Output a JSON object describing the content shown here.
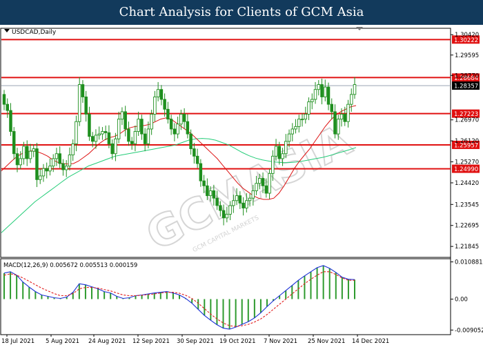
{
  "banner": {
    "title": "Chart Analysis for Clients of GCM Asia"
  },
  "colors": {
    "banner": "#123a5c",
    "bull_candle": "#1e8f1e",
    "bear_candle": "#1e8f1e",
    "ma_fast": "#dd1111",
    "ma_slow": "#22cc77",
    "level_line": "#e01010",
    "macd_main": "#1a2fd6",
    "macd_signal": "#e21b1b",
    "macd_hist": "#2d9a2d",
    "price_box": "#000000"
  },
  "chart_data": [
    {
      "type": "candlestick",
      "symbol_label": "USDCAD,Daily",
      "ylim": [
        1.2143,
        1.3065
      ],
      "y_ticks": [
        1.3042,
        1.29595,
        1.2877,
        1.2697,
        1.2612,
        1.2527,
        1.2442,
        1.23545,
        1.22695,
        1.21845
      ],
      "x_tick_labels": [
        "18 Jul 2021",
        "5 Aug 2021",
        "24 Aug 2021",
        "12 Sep 2021",
        "30 Sep 2021",
        "19 Oct 2021",
        "7 Nov 2021",
        "25 Nov 2021",
        "14 Dec 2021"
      ],
      "horizontal_levels": [
        {
          "value": 1.30222,
          "label": "1.30222"
        },
        {
          "value": 1.28684,
          "label": "1.28684"
        },
        {
          "value": 1.27223,
          "label": "1.27223"
        },
        {
          "value": 1.25957,
          "label": "1.25957"
        },
        {
          "value": 1.2499,
          "label": "1.24990"
        }
      ],
      "current_price": {
        "value": 1.28357,
        "label": "1.28357"
      },
      "close": [
        1.276,
        1.2735,
        1.265,
        1.256,
        1.2515,
        1.254,
        1.259,
        1.254,
        1.257,
        1.258,
        1.2455,
        1.247,
        1.25,
        1.249,
        1.251,
        1.254,
        1.256,
        1.252,
        1.2495,
        1.251,
        1.2555,
        1.26,
        1.269,
        1.284,
        1.279,
        1.272,
        1.263,
        1.261,
        1.2635,
        1.264,
        1.265,
        1.2645,
        1.26,
        1.256,
        1.262,
        1.27,
        1.273,
        1.266,
        1.261,
        1.26,
        1.265,
        1.27,
        1.264,
        1.26,
        1.266,
        1.272,
        1.279,
        1.282,
        1.278,
        1.274,
        1.27,
        1.266,
        1.264,
        1.268,
        1.272,
        1.269,
        1.264,
        1.258,
        1.255,
        1.252,
        1.245,
        1.243,
        1.239,
        1.241,
        1.238,
        1.235,
        1.233,
        1.23,
        1.2315,
        1.235,
        1.237,
        1.239,
        1.236,
        1.234,
        1.237,
        1.238,
        1.241,
        1.244,
        1.246,
        1.243,
        1.24,
        1.248,
        1.255,
        1.259,
        1.254,
        1.256,
        1.261,
        1.264,
        1.266,
        1.267,
        1.27,
        1.27,
        1.272,
        1.277,
        1.278,
        1.282,
        1.284,
        1.279,
        1.283,
        1.276,
        1.273,
        1.264,
        1.27,
        1.272,
        1.269,
        1.276,
        1.28,
        1.284
      ],
      "open": [
        1.28,
        1.276,
        1.2735,
        1.265,
        1.256,
        1.2515,
        1.254,
        1.259,
        1.254,
        1.257,
        1.258,
        1.2455,
        1.247,
        1.25,
        1.249,
        1.251,
        1.254,
        1.256,
        1.252,
        1.2495,
        1.251,
        1.2555,
        1.26,
        1.269,
        1.284,
        1.279,
        1.272,
        1.263,
        1.261,
        1.2635,
        1.264,
        1.265,
        1.2645,
        1.26,
        1.256,
        1.262,
        1.27,
        1.273,
        1.266,
        1.261,
        1.26,
        1.265,
        1.27,
        1.264,
        1.26,
        1.266,
        1.272,
        1.279,
        1.282,
        1.278,
        1.274,
        1.27,
        1.266,
        1.264,
        1.268,
        1.272,
        1.269,
        1.264,
        1.258,
        1.255,
        1.252,
        1.245,
        1.243,
        1.239,
        1.241,
        1.238,
        1.235,
        1.233,
        1.23,
        1.2315,
        1.235,
        1.237,
        1.239,
        1.236,
        1.234,
        1.237,
        1.238,
        1.241,
        1.244,
        1.246,
        1.243,
        1.24,
        1.248,
        1.255,
        1.259,
        1.254,
        1.256,
        1.261,
        1.264,
        1.266,
        1.267,
        1.27,
        1.27,
        1.272,
        1.277,
        1.278,
        1.282,
        1.284,
        1.279,
        1.283,
        1.276,
        1.273,
        1.264,
        1.27,
        1.272,
        1.269,
        1.276,
        1.28
      ],
      "ma_fast": [
        1.249,
        1.251,
        1.253,
        1.2548,
        1.256,
        1.2568,
        1.2572,
        1.2568,
        1.256,
        1.255,
        1.2535,
        1.2525,
        1.252,
        1.2518,
        1.252,
        1.253,
        1.2545,
        1.256,
        1.258,
        1.26,
        1.2615,
        1.2625,
        1.263,
        1.264,
        1.2655,
        1.2665,
        1.267,
        1.2672,
        1.2675,
        1.268,
        1.269,
        1.27,
        1.2705,
        1.27,
        1.2685,
        1.267,
        1.2655,
        1.264,
        1.262,
        1.26,
        1.258,
        1.256,
        1.254,
        1.2515,
        1.249,
        1.2465,
        1.244,
        1.242,
        1.2405,
        1.239,
        1.238,
        1.2375,
        1.2375,
        1.238,
        1.24,
        1.243,
        1.2465,
        1.25,
        1.253,
        1.2555,
        1.258,
        1.261,
        1.264,
        1.267,
        1.2695,
        1.2715,
        1.273,
        1.274,
        1.275,
        1.2755
      ],
      "ma_slow": [
        1.224,
        1.2265,
        1.229,
        1.2315,
        1.234,
        1.2365,
        1.2385,
        1.2405,
        1.2425,
        1.2445,
        1.2465,
        1.248,
        1.2495,
        1.251,
        1.252,
        1.253,
        1.254,
        1.255,
        1.2555,
        1.256,
        1.2565,
        1.257,
        1.2575,
        1.258,
        1.2585,
        1.259,
        1.2595,
        1.2605,
        1.2615,
        1.262,
        1.2622,
        1.262,
        1.2615,
        1.2605,
        1.2595,
        1.258,
        1.2565,
        1.2552,
        1.2542,
        1.2535,
        1.253,
        1.2526,
        1.2524,
        1.2524,
        1.2526,
        1.253,
        1.2535,
        1.254,
        1.2545,
        1.2552,
        1.256,
        1.2568,
        1.2576,
        1.2585
      ],
      "macd_title": "MACD(12,26,9) 0.005672 0.005513 0.000159",
      "macd_ylim": [
        -0.0102,
        0.0116
      ],
      "macd_ticks": [
        {
          "value": 0.010881,
          "label": "0.010881"
        },
        {
          "value": 0.0,
          "label": "0.00"
        },
        {
          "value": -0.009052,
          "label": "-0.009052"
        }
      ],
      "macd_main": [
        0.0076,
        0.008,
        0.007,
        0.005,
        0.0035,
        0.0022,
        0.0012,
        0.0008,
        0.0004,
        0.0002,
        0.0006,
        0.002,
        0.0045,
        0.0042,
        0.0036,
        0.003,
        0.0022,
        0.0018,
        0.0008,
        0.0002,
        0.0004,
        0.001,
        0.0012,
        0.0015,
        0.0018,
        0.002,
        0.0022,
        0.0018,
        0.0012,
        0.0002,
        -0.0012,
        -0.003,
        -0.0048,
        -0.0062,
        -0.0075,
        -0.0085,
        -0.0088,
        -0.0082,
        -0.0074,
        -0.0066,
        -0.0055,
        -0.004,
        -0.0022,
        -0.0005,
        0.001,
        0.0025,
        0.004,
        0.0055,
        0.0068,
        0.008,
        0.0092,
        0.0098,
        0.009,
        0.0078,
        0.0064,
        0.0058,
        0.0057
      ],
      "macd_signal": [
        0.007,
        0.0074,
        0.007,
        0.0062,
        0.0052,
        0.0042,
        0.0032,
        0.0024,
        0.0016,
        0.001,
        0.001,
        0.0016,
        0.003,
        0.0034,
        0.0034,
        0.0032,
        0.0028,
        0.0024,
        0.0018,
        0.0012,
        0.001,
        0.001,
        0.0011,
        0.0013,
        0.0015,
        0.0018,
        0.002,
        0.002,
        0.0017,
        0.0011,
        0.0002,
        -0.0012,
        -0.0028,
        -0.0044,
        -0.0058,
        -0.007,
        -0.0078,
        -0.008,
        -0.0078,
        -0.0074,
        -0.0067,
        -0.0058,
        -0.0045,
        -0.003,
        -0.0015,
        0.0,
        0.0015,
        0.003,
        0.0045,
        0.0058,
        0.007,
        0.008,
        0.008,
        0.0072,
        0.0062,
        0.0055,
        0.0055
      ]
    }
  ],
  "watermark": {
    "text": "GCMASIA",
    "subtext": "GCM CAPITAL MARKETS"
  }
}
